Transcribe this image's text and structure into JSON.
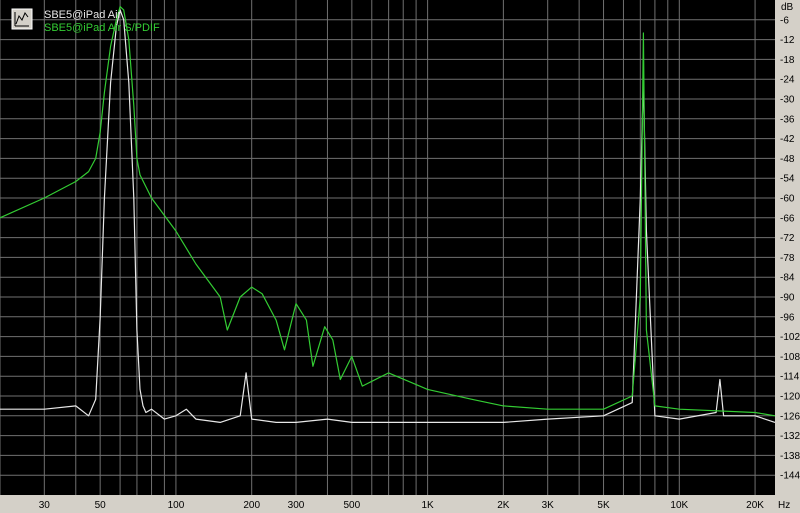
{
  "chart_data": {
    "type": "line",
    "title": "",
    "xlabel": "Hz",
    "ylabel": "dB",
    "x_scale": "log",
    "xlim": [
      20,
      24000
    ],
    "ylim": [
      -150,
      0
    ],
    "grid": true,
    "legend_placement": "top-left",
    "background_color": "#000000",
    "frame_color": "#d4d0c8",
    "grid_color": "#707070",
    "x_ticks": [
      30,
      50,
      100,
      200,
      300,
      500,
      "1K",
      "2K",
      "3K",
      "5K",
      "10K",
      "20K"
    ],
    "y_ticks": [
      -6,
      -12,
      -18,
      -24,
      -30,
      -36,
      -42,
      -48,
      -54,
      -60,
      -66,
      -72,
      -78,
      -84,
      -90,
      -96,
      -102,
      -108,
      -114,
      -120,
      -126,
      -132,
      -138,
      -144
    ],
    "series": [
      {
        "name": "SBE5@iPad Air",
        "color": "#e8e8e8",
        "x": [
          20,
          30,
          40,
          45,
          48,
          50,
          52,
          55,
          58,
          60,
          62,
          65,
          68,
          70,
          72,
          74,
          76,
          80,
          90,
          100,
          110,
          120,
          150,
          180,
          190,
          200,
          250,
          300,
          400,
          500,
          700,
          1000,
          1500,
          2000,
          3000,
          5000,
          6500,
          7000,
          7200,
          7400,
          8000,
          10000,
          14000,
          14500,
          15000,
          20000,
          24000
        ],
        "y": [
          -124,
          -124,
          -123,
          -126,
          -121,
          -96,
          -60,
          -25,
          -8,
          -3,
          -6,
          -25,
          -60,
          -100,
          -118,
          -123,
          -125,
          -124,
          -127,
          -126,
          -124,
          -127,
          -128,
          -126,
          -113,
          -127,
          -128,
          -128,
          -127,
          -128,
          -128,
          -128,
          -128,
          -128,
          -127,
          -126,
          -122,
          -60,
          -24,
          -70,
          -126,
          -127,
          -125,
          -115,
          -126,
          -126,
          -128
        ]
      },
      {
        "name": "SBE5@iPad Air S/PDIF",
        "color": "#33cc33",
        "x": [
          20,
          30,
          40,
          45,
          48,
          50,
          52,
          55,
          58,
          60,
          62,
          65,
          68,
          70,
          72,
          80,
          100,
          120,
          150,
          160,
          180,
          200,
          220,
          250,
          270,
          300,
          330,
          350,
          390,
          420,
          450,
          500,
          550,
          700,
          1000,
          1500,
          2000,
          3000,
          5000,
          6500,
          7000,
          7200,
          7400,
          8000,
          10000,
          20000,
          24000
        ],
        "y": [
          -66,
          -60,
          -55,
          -52,
          -48,
          -40,
          -28,
          -14,
          -6,
          -2,
          -3,
          -12,
          -32,
          -48,
          -53,
          -60,
          -70,
          -80,
          -90,
          -100,
          -90,
          -87,
          -89,
          -97,
          -106,
          -92,
          -97,
          -111,
          -99,
          -103,
          -115,
          -108,
          -117,
          -113,
          -118,
          -121,
          -123,
          -124,
          -124,
          -120,
          -90,
          -10,
          -100,
          -123,
          -124,
          -125,
          -126
        ]
      }
    ]
  }
}
